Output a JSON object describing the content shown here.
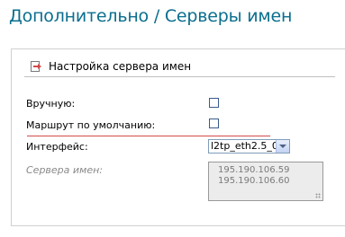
{
  "header": {
    "title": "Дополнительно  / Серверы имен"
  },
  "section": {
    "title": "Настройка сервера имен",
    "icon": "panel-arrow-icon"
  },
  "form": {
    "manual_label": "Вручную:",
    "manual_checked": false,
    "default_route_label": "Маршрут по умолчанию:",
    "default_route_checked": false,
    "interface_label": "Интерфейс:",
    "interface_value": "l2tp_eth2.5_0",
    "name_servers_label": "Сервера имен:",
    "name_servers": [
      "195.190.106.59",
      "195.190.106.60"
    ]
  },
  "colors": {
    "title": "#0a6e8e",
    "underline": "#d24a4a"
  }
}
